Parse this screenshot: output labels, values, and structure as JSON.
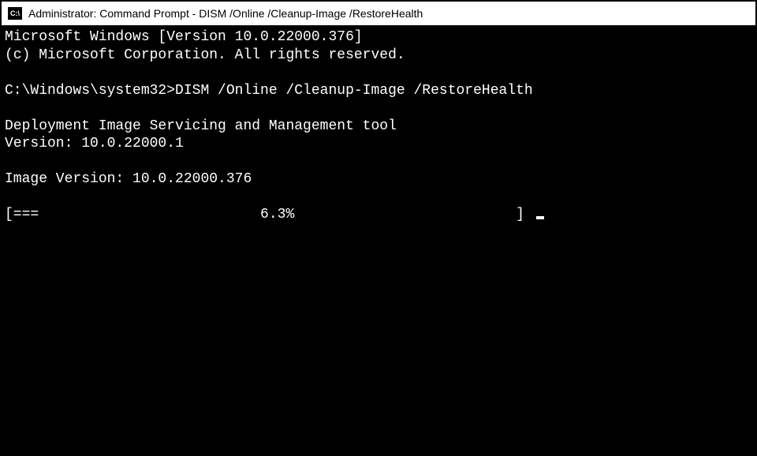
{
  "titlebar": {
    "icon_label": "C:\\",
    "title": "Administrator: Command Prompt - DISM  /Online /Cleanup-Image /RestoreHealth"
  },
  "terminal": {
    "line1": "Microsoft Windows [Version 10.0.22000.376]",
    "line2": "(c) Microsoft Corporation. All rights reserved.",
    "blank1": "",
    "prompt_line": "C:\\Windows\\system32>DISM /Online /Cleanup-Image /RestoreHealth",
    "blank2": "",
    "tool_line1": "Deployment Image Servicing and Management tool",
    "tool_line2": "Version: 10.0.22000.1",
    "blank3": "",
    "image_version": "Image Version: 10.0.22000.376",
    "blank4": "",
    "progress": "[===                          6.3%                          ] "
  }
}
